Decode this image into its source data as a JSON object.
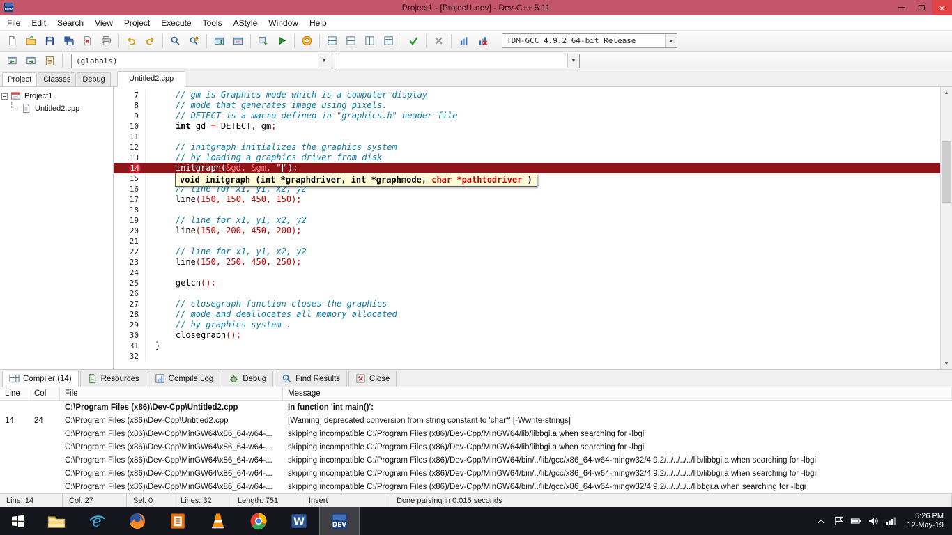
{
  "window": {
    "title": "Project1 - [Project1.dev] - Dev-C++ 5.11"
  },
  "menu": {
    "items": [
      "File",
      "Edit",
      "Search",
      "View",
      "Project",
      "Execute",
      "Tools",
      "AStyle",
      "Window",
      "Help"
    ]
  },
  "toolbar1": {
    "groups": [
      [
        "new-file",
        "open",
        "save",
        "save-all",
        "close-file",
        "print"
      ],
      [
        "undo",
        "redo"
      ],
      [
        "find",
        "replace"
      ],
      [
        "new-project",
        "open-project"
      ],
      [
        "compile",
        "run"
      ],
      [
        "compile-and-run"
      ],
      [
        "rebuild-all",
        "project-add",
        "project-remove",
        "project-options"
      ],
      [
        "syntax-check"
      ],
      [
        "abort-compilation"
      ],
      [
        "profile",
        "delete-profiling"
      ]
    ],
    "compiler_combo": "TDM-GCC 4.9.2 64-bit Release"
  },
  "toolbar2": {
    "icons": [
      "goto-declaration",
      "goto-definition",
      "class-browser"
    ],
    "globals_combo": "(globals)",
    "members_combo": ""
  },
  "left_tabs": [
    {
      "label": "Project",
      "active": true
    },
    {
      "label": "Classes",
      "active": false
    },
    {
      "label": "Debug",
      "active": false
    }
  ],
  "tree": {
    "root": "Project1",
    "child": "Untitled2.cpp"
  },
  "editor_tab": {
    "label": "Untitled2.cpp"
  },
  "editor": {
    "breakpoint_line": 14,
    "lines": [
      {
        "n": 7,
        "seg": [
          [
            "c",
            "    // gm is Graphics mode which is a computer display"
          ]
        ]
      },
      {
        "n": 8,
        "seg": [
          [
            "c",
            "    // mode that generates image using pixels."
          ]
        ]
      },
      {
        "n": 9,
        "seg": [
          [
            "c",
            "    // DETECT is a macro defined in \"graphics.h\" header file"
          ]
        ]
      },
      {
        "n": 10,
        "seg": [
          [
            "p",
            "    "
          ],
          [
            "k",
            "int"
          ],
          [
            "p",
            " gd "
          ],
          [
            "r",
            "="
          ],
          [
            "p",
            " DETECT"
          ],
          [
            "r",
            ","
          ],
          [
            "p",
            " gm"
          ],
          [
            "r",
            ";"
          ]
        ]
      },
      {
        "n": 11,
        "seg": []
      },
      {
        "n": 12,
        "seg": [
          [
            "c",
            "    // initgraph initializes the graphics system"
          ]
        ]
      },
      {
        "n": 13,
        "seg": [
          [
            "c",
            "    // by loading a graphics driver from disk"
          ]
        ]
      },
      {
        "n": 14,
        "hl": true,
        "bp": true,
        "seg": [
          [
            "w",
            "    initgraph("
          ],
          [
            "pk",
            "&gd, &gm, "
          ],
          [
            "w",
            "\""
          ],
          [
            "caret",
            ""
          ],
          [
            "w",
            "\");"
          ]
        ]
      },
      {
        "n": 15,
        "seg": []
      },
      {
        "n": 16,
        "seg": [
          [
            "c",
            "    // line for x1, y1, x2, y2"
          ]
        ]
      },
      {
        "n": 17,
        "seg": [
          [
            "p",
            "    line"
          ],
          [
            "r",
            "(150, 150, 450, 150);"
          ]
        ]
      },
      {
        "n": 18,
        "seg": []
      },
      {
        "n": 19,
        "seg": [
          [
            "c",
            "    // line for x1, y1, x2, y2"
          ]
        ]
      },
      {
        "n": 20,
        "seg": [
          [
            "p",
            "    line"
          ],
          [
            "r",
            "(150, 200, 450, 200);"
          ]
        ]
      },
      {
        "n": 21,
        "seg": []
      },
      {
        "n": 22,
        "seg": [
          [
            "c",
            "    // line for x1, y1, x2, y2"
          ]
        ]
      },
      {
        "n": 23,
        "seg": [
          [
            "p",
            "    line"
          ],
          [
            "r",
            "(150, 250, 450, 250);"
          ]
        ]
      },
      {
        "n": 24,
        "seg": []
      },
      {
        "n": 25,
        "seg": [
          [
            "p",
            "    getch"
          ],
          [
            "r",
            "();"
          ]
        ]
      },
      {
        "n": 26,
        "seg": []
      },
      {
        "n": 27,
        "seg": [
          [
            "c",
            "    // closegraph function closes the graphics"
          ]
        ]
      },
      {
        "n": 28,
        "seg": [
          [
            "c",
            "    // mode and deallocates all memory allocated"
          ]
        ]
      },
      {
        "n": 29,
        "seg": [
          [
            "c",
            "    // by graphics system ."
          ]
        ]
      },
      {
        "n": 30,
        "seg": [
          [
            "p",
            "    closegraph"
          ],
          [
            "r",
            "();"
          ]
        ]
      },
      {
        "n": 31,
        "seg": [
          [
            "p",
            "}"
          ]
        ]
      },
      {
        "n": 32,
        "seg": []
      }
    ],
    "tooltip": {
      "parts": [
        [
          "b",
          "void initgraph (int *graphdriver, int *graphmode, "
        ],
        [
          "r",
          "char *pathtodriver"
        ],
        [
          "b",
          " )"
        ]
      ]
    }
  },
  "compiler_panel": {
    "tabs": [
      {
        "label": "Compiler (14)",
        "icon": "compiler",
        "active": true
      },
      {
        "label": "Resources",
        "icon": "resources",
        "active": false
      },
      {
        "label": "Compile Log",
        "icon": "compile-log",
        "active": false
      },
      {
        "label": "Debug",
        "icon": "debug",
        "active": false
      },
      {
        "label": "Find Results",
        "icon": "find-results",
        "active": false
      },
      {
        "label": "Close",
        "icon": "close-panel",
        "active": false
      }
    ],
    "columns": [
      "Line",
      "Col",
      "File",
      "Message"
    ],
    "rows": [
      {
        "line": "",
        "col": "",
        "file": "C:\\Program Files (x86)\\Dev-Cpp\\Untitled2.cpp",
        "message": "In function 'int main()':",
        "bold": true
      },
      {
        "line": "14",
        "col": "24",
        "file": "C:\\Program Files (x86)\\Dev-Cpp\\Untitled2.cpp",
        "message": "[Warning] deprecated conversion from string constant to 'char*' [-Wwrite-strings]",
        "bold": false
      },
      {
        "line": "",
        "col": "",
        "file": "C:\\Program Files (x86)\\Dev-Cpp\\MinGW64\\x86_64-w64-...",
        "message": "skipping incompatible C:/Program Files (x86)/Dev-Cpp/MinGW64/lib/libbgi.a when searching for -lbgi",
        "bold": false
      },
      {
        "line": "",
        "col": "",
        "file": "C:\\Program Files (x86)\\Dev-Cpp\\MinGW64\\x86_64-w64-...",
        "message": "skipping incompatible C:/Program Files (x86)/Dev-Cpp/MinGW64/lib/libbgi.a when searching for -lbgi",
        "bold": false
      },
      {
        "line": "",
        "col": "",
        "file": "C:\\Program Files (x86)\\Dev-Cpp\\MinGW64\\x86_64-w64-...",
        "message": "skipping incompatible C:/Program Files (x86)/Dev-Cpp/MinGW64/bin/../lib/gcc/x86_64-w64-mingw32/4.9.2/../../../../lib/libbgi.a when searching for -lbgi",
        "bold": false
      },
      {
        "line": "",
        "col": "",
        "file": "C:\\Program Files (x86)\\Dev-Cpp\\MinGW64\\x86_64-w64-...",
        "message": "skipping incompatible C:/Program Files (x86)/Dev-Cpp/MinGW64/bin/../lib/gcc/x86_64-w64-mingw32/4.9.2/../../../../lib/libbgi.a when searching for -lbgi",
        "bold": false
      },
      {
        "line": "",
        "col": "",
        "file": "C:\\Program Files (x86)\\Dev-Cpp\\MinGW64\\x86_64-w64-...",
        "message": "skipping incompatible C:/Program Files (x86)/Dev-Cpp/MinGW64/bin/../lib/gcc/x86_64-w64-mingw32/4.9.2/../../../../libbgi.a when searching for -lbgi",
        "bold": false
      }
    ]
  },
  "statusbar": {
    "line": "Line: 14",
    "col": "Col: 27",
    "sel": "Sel: 0",
    "lines": "Lines: 32",
    "length": "Length: 751",
    "mode": "Insert",
    "message": "Done parsing in 0.015 seconds"
  },
  "taskbar": {
    "apps": [
      {
        "name": "file-explorer",
        "active": false
      },
      {
        "name": "internet-explorer",
        "active": false
      },
      {
        "name": "firefox",
        "active": false
      },
      {
        "name": "office-app",
        "active": false
      },
      {
        "name": "vlc",
        "active": false
      },
      {
        "name": "chrome",
        "active": false
      },
      {
        "name": "word",
        "active": false
      },
      {
        "name": "dev-cpp",
        "active": true
      }
    ],
    "tray": [
      "tray-expand",
      "action-center",
      "battery",
      "volume",
      "network"
    ],
    "clock": {
      "time": "5:26 PM",
      "date": "12-May-19"
    }
  },
  "colors": {
    "titlebar": "#c4566b",
    "close_button": "#e04345",
    "breakpoint_line_bg": "#8e1418",
    "comment_text": "#0d7ca5",
    "number_symbol_text": "#c00000",
    "tooltip_bg": "#fffbd6",
    "tooltip_param_highlight": "#c00000"
  }
}
